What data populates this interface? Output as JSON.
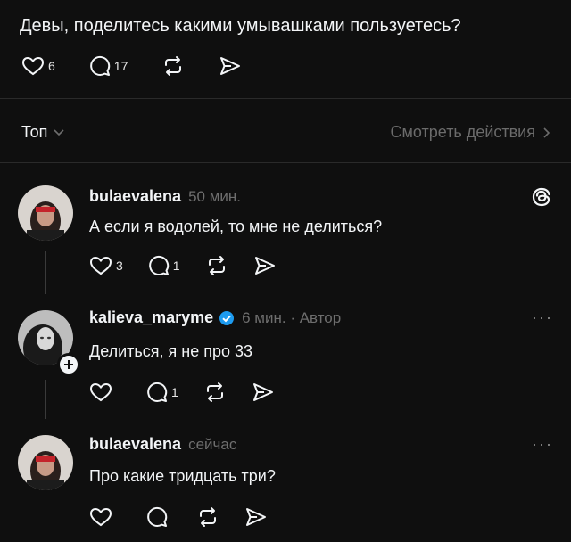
{
  "post": {
    "text": "Девы, поделитесь какими умывашками пользуетесь?",
    "likes": "6",
    "replies": "17"
  },
  "sort": {
    "label": "Топ"
  },
  "view_activity": {
    "label": "Смотреть действия"
  },
  "threads_icon": "threads-icon",
  "replies": [
    {
      "username": "bulaevalena",
      "time": "50 мин.",
      "text": "А если я водолей, то мне не делиться?",
      "likes": "3",
      "replies": "1"
    },
    {
      "username": "kalieva_maryme",
      "time": "6 мин. · Автор",
      "text": "Делиться, я не про 33",
      "likes": "",
      "replies": "1"
    },
    {
      "username": "bulaevalena",
      "time": "сейчас",
      "text": "Про какие тридцать три?",
      "likes": "",
      "replies": ""
    }
  ],
  "colors": {
    "background": "#0f0f0f",
    "text": "#f3f5f7",
    "muted": "#6e6e6e",
    "verified": "#1d9bf0"
  }
}
